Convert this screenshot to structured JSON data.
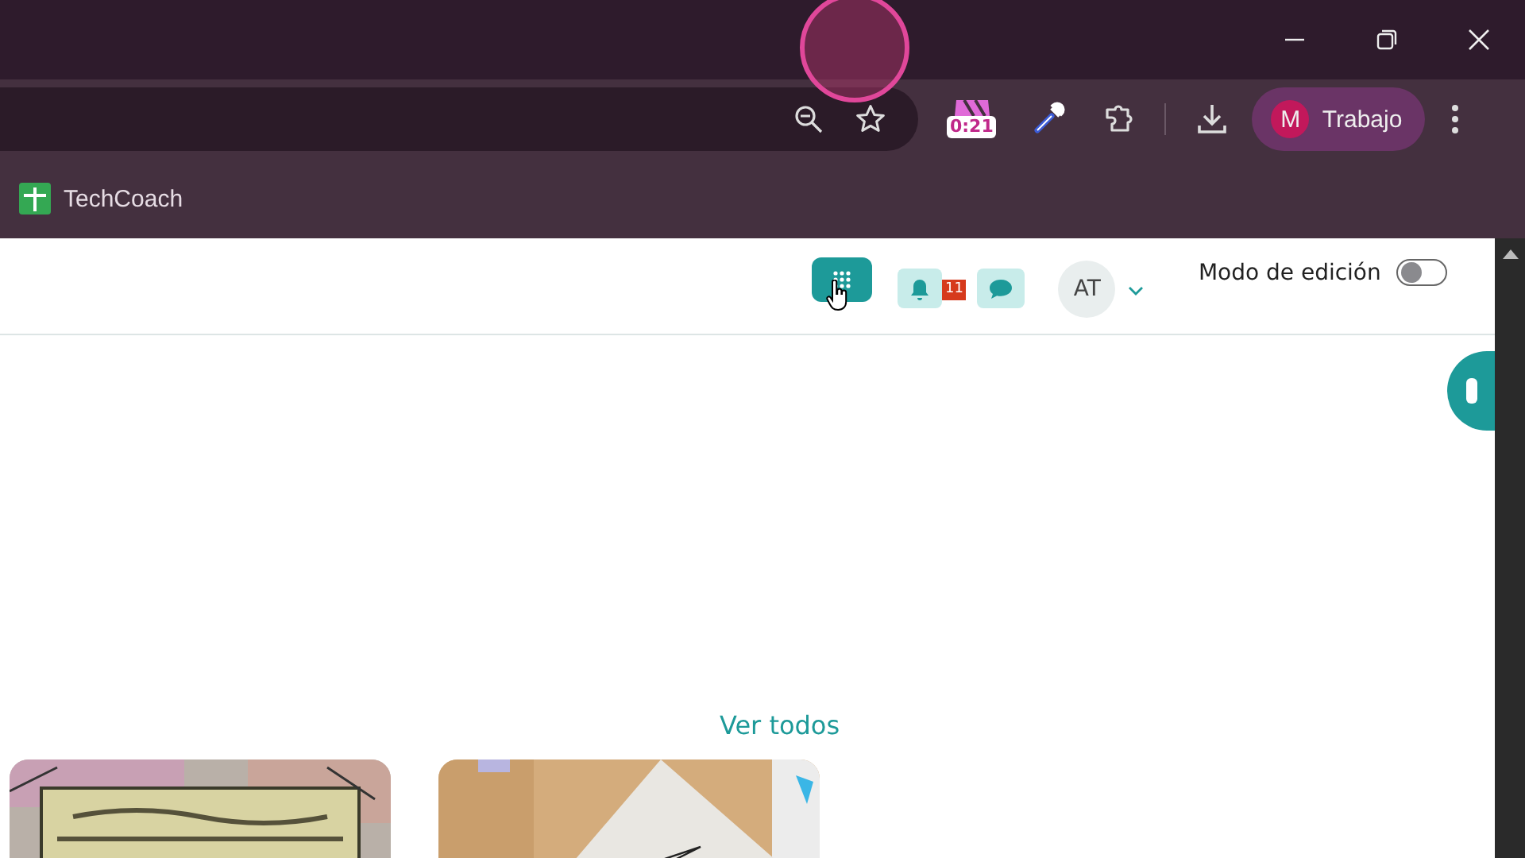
{
  "browser": {
    "timer": "0:21",
    "profile": {
      "initial": "M",
      "name": "Trabajo"
    },
    "bookmarks": [
      {
        "label": "TechCoach"
      }
    ]
  },
  "header": {
    "notification_count": "11",
    "avatar": "AT",
    "edit_mode": {
      "label": "Modo de edición",
      "on": false
    }
  },
  "section": {
    "link": "Ver todos"
  }
}
